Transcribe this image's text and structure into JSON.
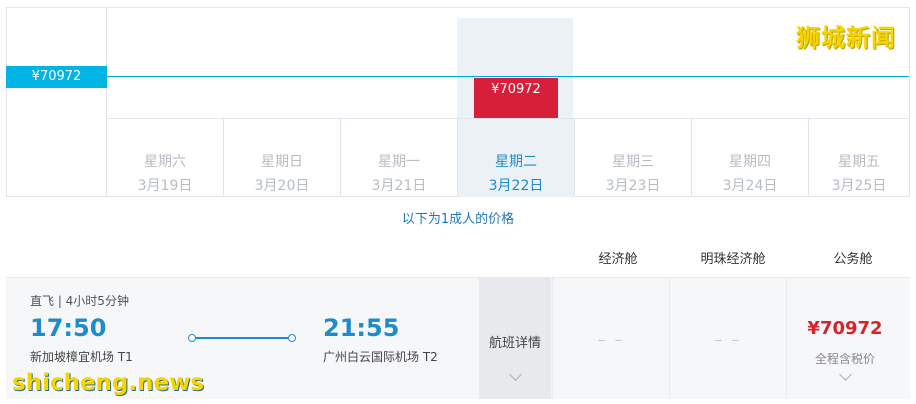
{
  "watermarks": {
    "top": "狮城新闻",
    "bottom": "shicheng.news"
  },
  "chart": {
    "y_tag": "¥70972",
    "selected_price": "¥70972",
    "dates": [
      {
        "weekday": "星期六",
        "date": "3月19日"
      },
      {
        "weekday": "星期日",
        "date": "3月20日"
      },
      {
        "weekday": "星期一",
        "date": "3月21日"
      },
      {
        "weekday": "星期二",
        "date": "3月22日",
        "selected": true
      },
      {
        "weekday": "星期三",
        "date": "3月23日"
      },
      {
        "weekday": "星期四",
        "date": "3月24日"
      },
      {
        "weekday": "星期五",
        "date": "3月25日"
      }
    ]
  },
  "note": "以下为1成人的价格",
  "cabins": [
    "经济舱",
    "明珠经济舱",
    "公务舱"
  ],
  "flight": {
    "meta": "直飞 | 4小时5分钟",
    "depart_time": "17:50",
    "depart_airport": "新加坡樟宜机场 T1",
    "arrive_time": "21:55",
    "arrive_airport": "广州白云国际机场 T2",
    "details_label": "航班详情",
    "fares": [
      {
        "cabin": "经济舱",
        "value": "– –"
      },
      {
        "cabin": "明珠经济舱",
        "value": "– –"
      },
      {
        "cabin": "公务舱",
        "price": "¥70972",
        "note": "全程含税价"
      }
    ]
  },
  "colors": {
    "accent": "#1f8cc9",
    "price_red": "#d8232a",
    "line": "#00a6e0"
  }
}
